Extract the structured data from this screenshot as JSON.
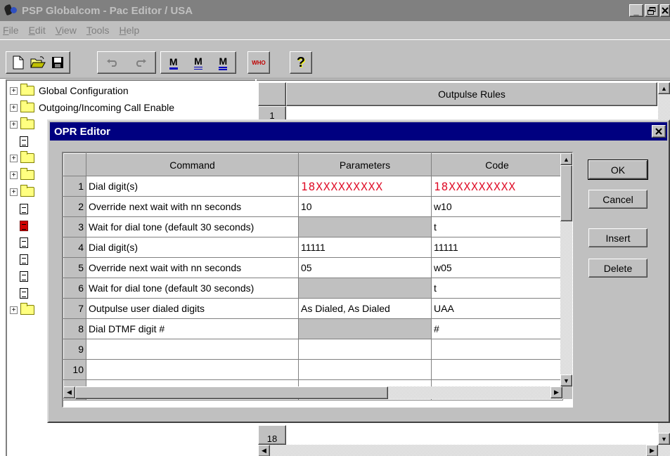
{
  "window": {
    "title": "PSP Globalcom - Pac Editor / USA",
    "controls": [
      "_",
      "Ч",
      "X"
    ]
  },
  "menu": [
    "File",
    "Edit",
    "View",
    "Tools",
    "Help"
  ],
  "toolbar": {
    "buttons": [
      "new-icon",
      "open-icon",
      "save-icon",
      "undo-icon",
      "redo-icon",
      "M1",
      "M2",
      "M3",
      "WHO",
      "?"
    ],
    "m_label": "M",
    "who_label": "WHO",
    "help_label": "?"
  },
  "tree": {
    "items": [
      {
        "type": "folder",
        "label": "Global Configuration"
      },
      {
        "type": "folder",
        "label": "Outgoing/Incoming Call Enable"
      }
    ]
  },
  "background_grid": {
    "header": "Outpulse Rules",
    "first_row": "1",
    "last_row": "18"
  },
  "dialog": {
    "title": "OPR Editor",
    "close": "X",
    "columns": [
      "Command",
      "Parameters",
      "Code"
    ],
    "rows": [
      {
        "n": "1",
        "command": "Dial digit(s)",
        "params": "18XXXXXXXXX",
        "code": "18XXXXXXXXX",
        "params_gray": false,
        "red": true
      },
      {
        "n": "2",
        "command": "Override next wait with nn seconds",
        "params": "10",
        "code": "w10",
        "params_gray": false,
        "red": false
      },
      {
        "n": "3",
        "command": "Wait for dial tone (default 30 seconds)",
        "params": "",
        "code": "t",
        "params_gray": true,
        "red": false
      },
      {
        "n": "4",
        "command": "Dial digit(s)",
        "params": "11111",
        "code": "11111",
        "params_gray": false,
        "red": false
      },
      {
        "n": "5",
        "command": "Override next wait with nn seconds",
        "params": "05",
        "code": "w05",
        "params_gray": false,
        "red": false
      },
      {
        "n": "6",
        "command": "Wait for dial tone (default 30 seconds)",
        "params": "",
        "code": "t",
        "params_gray": true,
        "red": false
      },
      {
        "n": "7",
        "command": "Outpulse user dialed digits",
        "params": "As Dialed, As Dialed",
        "code": "UAA",
        "params_gray": false,
        "red": false
      },
      {
        "n": "8",
        "command": "Dial DTMF digit #",
        "params": "",
        "code": "#",
        "params_gray": true,
        "red": false
      },
      {
        "n": "9",
        "command": "",
        "params": "",
        "code": "",
        "params_gray": false,
        "red": false
      },
      {
        "n": "10",
        "command": "",
        "params": "",
        "code": "",
        "params_gray": false,
        "red": false
      },
      {
        "n": "",
        "command": "",
        "params": "",
        "code": "",
        "params_gray": false,
        "red": false
      }
    ],
    "buttons": {
      "ok": "OK",
      "cancel": "Cancel",
      "insert": "Insert",
      "delete": "Delete"
    }
  },
  "colors": {
    "dialog_title_bg": "#000080",
    "red_text": "#e0102a",
    "face": "#c0c0c0"
  }
}
